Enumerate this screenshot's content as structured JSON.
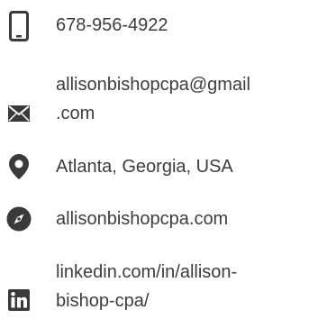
{
  "contact": {
    "phone": {
      "icon": "phone-icon",
      "value": "678-956-4922"
    },
    "email": {
      "icon": "envelope-icon",
      "line1": "allisonbishopcpa@gmail",
      "line2": ".com"
    },
    "location": {
      "icon": "map-pin-icon",
      "value": "Atlanta, Georgia, USA"
    },
    "website": {
      "icon": "compass-icon",
      "value": "allisonbishopcpa.com"
    },
    "linkedin": {
      "icon": "linkedin-icon",
      "line1": "linkedin.com/in/allison-",
      "line2": "bishop-cpa/"
    }
  },
  "colors": {
    "icon": "#3a3a3a",
    "text": "#3d3d3d",
    "background": "#ffffff"
  }
}
